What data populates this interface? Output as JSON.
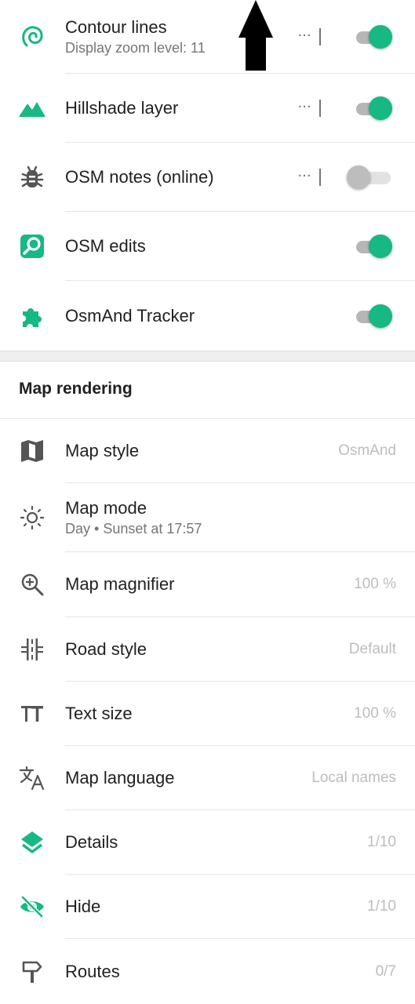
{
  "layers": [
    {
      "title": "Contour lines",
      "subtitle": "Display zoom level: 11",
      "icon": "contour-icon",
      "has_menu": true,
      "enabled": true
    },
    {
      "title": "Hillshade layer",
      "icon": "mountain-icon",
      "has_menu": true,
      "enabled": true
    },
    {
      "title": "OSM notes (online)",
      "icon": "bug-icon",
      "has_menu": true,
      "enabled": false
    },
    {
      "title": "OSM edits",
      "icon": "osm-edit-icon",
      "has_menu": false,
      "enabled": true
    },
    {
      "title": "OsmAnd Tracker",
      "icon": "puzzle-icon",
      "has_menu": false,
      "enabled": true
    }
  ],
  "map_rendering": {
    "section_title": "Map rendering",
    "items": [
      {
        "title": "Map style",
        "value": "OsmAnd",
        "icon": "map-icon"
      },
      {
        "title": "Map mode",
        "subtitle": "Day • Sunset at 17:57",
        "icon": "sun-icon"
      },
      {
        "title": "Map magnifier",
        "value": "100 %",
        "icon": "zoom-in-icon"
      },
      {
        "title": "Road style",
        "value": "Default",
        "icon": "road-icon"
      },
      {
        "title": "Text size",
        "value": "100 %",
        "icon": "text-size-icon"
      },
      {
        "title": "Map language",
        "value": "Local names",
        "icon": "translate-icon"
      },
      {
        "title": "Details",
        "value": "1/10",
        "icon": "layers-icon"
      },
      {
        "title": "Hide",
        "value": "1/10",
        "icon": "eye-off-icon"
      },
      {
        "title": "Routes",
        "value": "0/7",
        "icon": "signpost-icon"
      }
    ]
  },
  "menu_glyph": "···",
  "colors": {
    "accent": "#16b884",
    "icon_grey": "#555555",
    "text_primary": "#212121",
    "text_secondary": "#757575",
    "value_grey": "#bdbdbd"
  }
}
